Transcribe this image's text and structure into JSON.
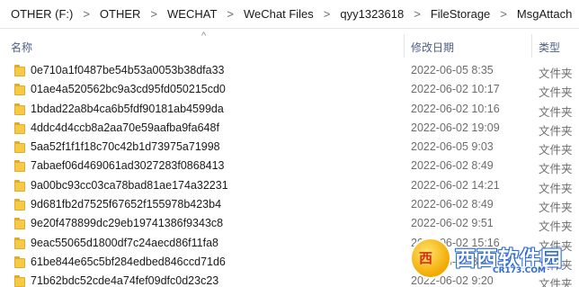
{
  "breadcrumb": [
    "OTHER (F:)",
    "OTHER",
    "WECHAT",
    "WeChat Files",
    "qyy1323618",
    "FileStorage",
    "MsgAttach"
  ],
  "breadcrumb_separator": ">",
  "columns": {
    "name": "名称",
    "date": "修改日期",
    "type": "类型",
    "sort_indicator": "^"
  },
  "rows": [
    {
      "name": "0e710a1f0487be54b53a0053b38dfa33",
      "date": "2022-06-05 8:35",
      "type": "文件夹"
    },
    {
      "name": "01ae4a520562bc9a3cd95fd050215cd0",
      "date": "2022-06-02 10:17",
      "type": "文件夹"
    },
    {
      "name": "1bdad22a8b4ca6b5fdf90181ab4599da",
      "date": "2022-06-02 10:16",
      "type": "文件夹"
    },
    {
      "name": "4ddc4d4ccb8a2aa70e59aafba9fa648f",
      "date": "2022-06-02 19:09",
      "type": "文件夹"
    },
    {
      "name": "5aa52f1f1f18c70c42b1d73975a71998",
      "date": "2022-06-05 9:03",
      "type": "文件夹"
    },
    {
      "name": "7abaef06d469061ad3027283f0868413",
      "date": "2022-06-02 8:49",
      "type": "文件夹"
    },
    {
      "name": "9a00bc93cc03ca78bad81ae174a32231",
      "date": "2022-06-02 14:21",
      "type": "文件夹"
    },
    {
      "name": "9d681fb2d7525f67652f155978b423b4",
      "date": "2022-06-02 8:49",
      "type": "文件夹"
    },
    {
      "name": "9e20f478899dc29eb19741386f9343c8",
      "date": "2022-06-02 9:51",
      "type": "文件夹"
    },
    {
      "name": "9eac55065d1800df7c24aecd86f11fa8",
      "date": "2022-06-02 15:16",
      "type": "文件夹"
    },
    {
      "name": "61be844e65c5bf284edbed846ccd71d6",
      "date": "2022-06-02 8:49",
      "type": "文件夹"
    },
    {
      "name": "71b62bdc52cde4a74fef09dfc0d23c23",
      "date": "2022-06-02 9:20",
      "type": "文件夹"
    }
  ],
  "watermark": {
    "badge": "西",
    "brand": "西西软件园",
    "domain": "CR173.COM"
  },
  "colors": {
    "folder": "#f7c948",
    "header_text": "#4d6082",
    "date_text": "#6d6d6d"
  }
}
